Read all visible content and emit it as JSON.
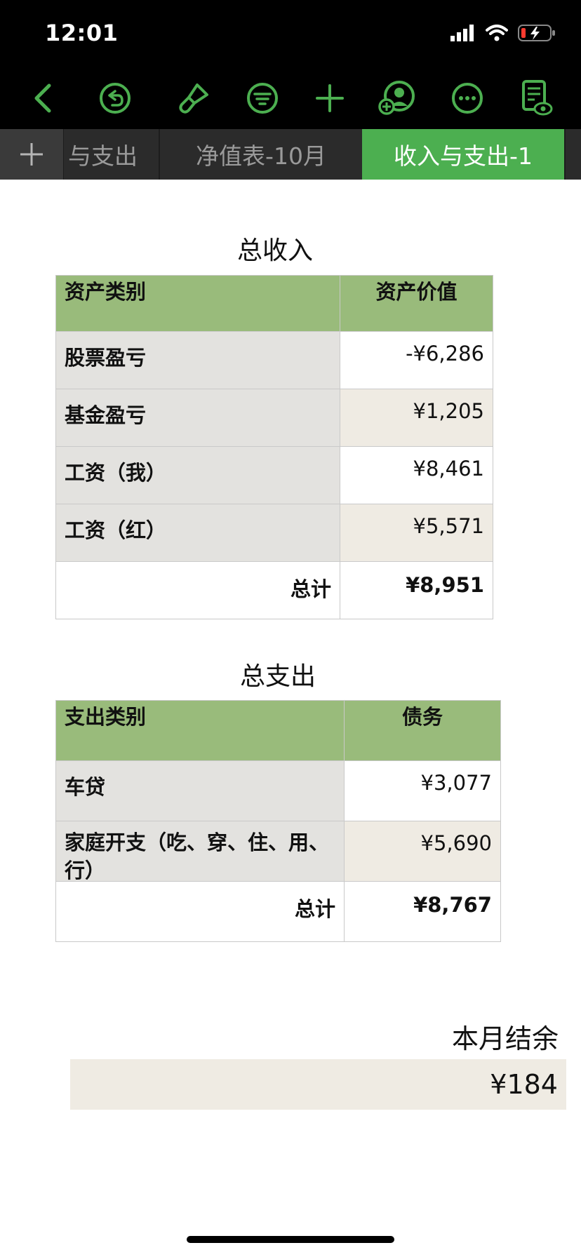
{
  "status": {
    "time": "12:01"
  },
  "tabs": {
    "partial_label": "与支出",
    "items": [
      {
        "label": "净值表-10月"
      },
      {
        "label": "收入与支出-1"
      }
    ]
  },
  "income": {
    "title": "总收入",
    "headers": [
      "资产类别",
      "资产价值"
    ],
    "rows": [
      {
        "category": "股票盈亏",
        "value": "-¥6,286"
      },
      {
        "category": "基金盈亏",
        "value": "¥1,205"
      },
      {
        "category": "工资（我）",
        "value": "¥8,461"
      },
      {
        "category": "工资（红）",
        "value": "¥5,571"
      }
    ],
    "total_label": "总计",
    "total_value": "¥8,951"
  },
  "expense": {
    "title": "总支出",
    "headers": [
      "支出类别",
      "债务"
    ],
    "rows": [
      {
        "category": "车贷",
        "value": "¥3,077"
      },
      {
        "category": "家庭开支（吃、穿、住、用、行）",
        "value": "¥5,690"
      }
    ],
    "total_label": "总计",
    "total_value": "¥8,767"
  },
  "balance": {
    "label": "本月结余",
    "value": "¥184"
  },
  "colors": {
    "accent_green": "#4caf50",
    "header_green": "#99bb7b",
    "category_gray": "#e3e2df",
    "beige": "#efebe3"
  }
}
